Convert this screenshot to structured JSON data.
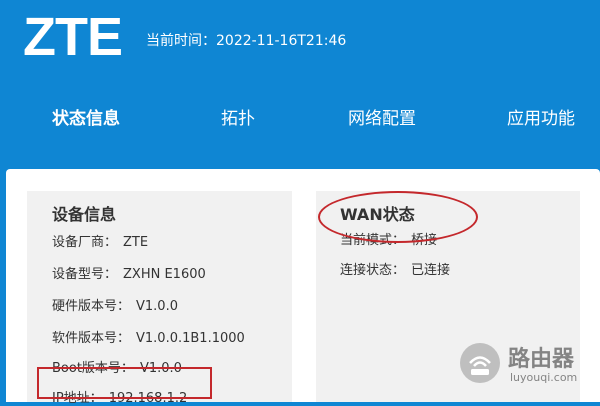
{
  "header": {
    "logo": "ZTE",
    "time_label": "当前时间：",
    "time_value": "2022-11-16T21:46"
  },
  "nav": [
    {
      "label": "状态信息",
      "active": true
    },
    {
      "label": "拓扑",
      "active": false
    },
    {
      "label": "网络配置",
      "active": false
    },
    {
      "label": "应用功能",
      "active": false
    }
  ],
  "device_info": {
    "title": "设备信息",
    "rows": [
      {
        "label": "设备厂商：",
        "value": "ZTE"
      },
      {
        "label": "设备型号：",
        "value": "ZXHN E1600"
      },
      {
        "label": "硬件版本号：",
        "value": "V1.0.0"
      },
      {
        "label": "软件版本号：",
        "value": "V1.0.0.1B1.1000"
      },
      {
        "label": "Boot版本号：",
        "value": "V1.0.0"
      },
      {
        "label": "IP地址：",
        "value": "192.168.1.2"
      }
    ]
  },
  "wan_status": {
    "title": "WAN状态",
    "rows": [
      {
        "label": "当前模式：",
        "value": "桥接"
      },
      {
        "label": "连接状态：",
        "value": "已连接"
      }
    ]
  },
  "watermark": {
    "title": "路由器",
    "url": "luyouqi.com"
  },
  "colors": {
    "header_blue": "#0f86d3",
    "highlight_red": "#c4282c",
    "panel_bg": "#f1f1f1"
  }
}
